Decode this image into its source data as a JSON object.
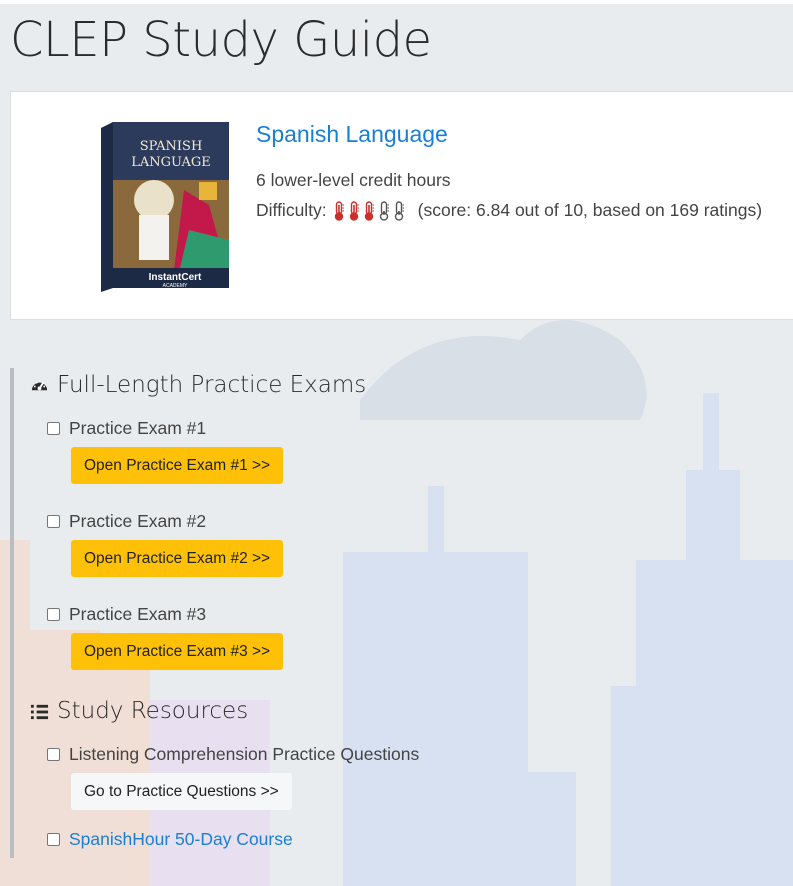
{
  "page_title": "CLEP Study Guide",
  "course": {
    "name": "Spanish Language",
    "credit_hours": "6 lower-level credit hours",
    "difficulty_label": "Difficulty:",
    "difficulty_filled": 3,
    "difficulty_total": 5,
    "score_text": "(score: 6.84 out of 10, based on 169 ratings)",
    "book": {
      "title_line1": "SPANISH",
      "title_line2": "LANGUAGE",
      "spine_text": "SPANISH LANGUAGE",
      "publisher": "InstantCert",
      "publisher_sub": "ACADEMY"
    }
  },
  "sections": {
    "practice_exams": {
      "heading": "Full-Length Practice Exams",
      "icon": "dashboard-icon",
      "items": [
        {
          "label": "Practice Exam #1",
          "button": "Open Practice Exam #1 >>"
        },
        {
          "label": "Practice Exam #2",
          "button": "Open Practice Exam #2 >>"
        },
        {
          "label": "Practice Exam #3",
          "button": "Open Practice Exam #3 >>"
        }
      ]
    },
    "study_resources": {
      "heading": "Study Resources",
      "icon": "numbered-list-icon",
      "items": [
        {
          "label": "Listening Comprehension Practice Questions",
          "button": "Go to Practice Questions >>"
        },
        {
          "label": "SpanishHour 50-Day Course"
        }
      ]
    }
  },
  "colors": {
    "link": "#1a7fd4",
    "button_primary": "#ffc107",
    "thermometer_active": "#c9302c",
    "thermometer_inactive": "#555555"
  }
}
